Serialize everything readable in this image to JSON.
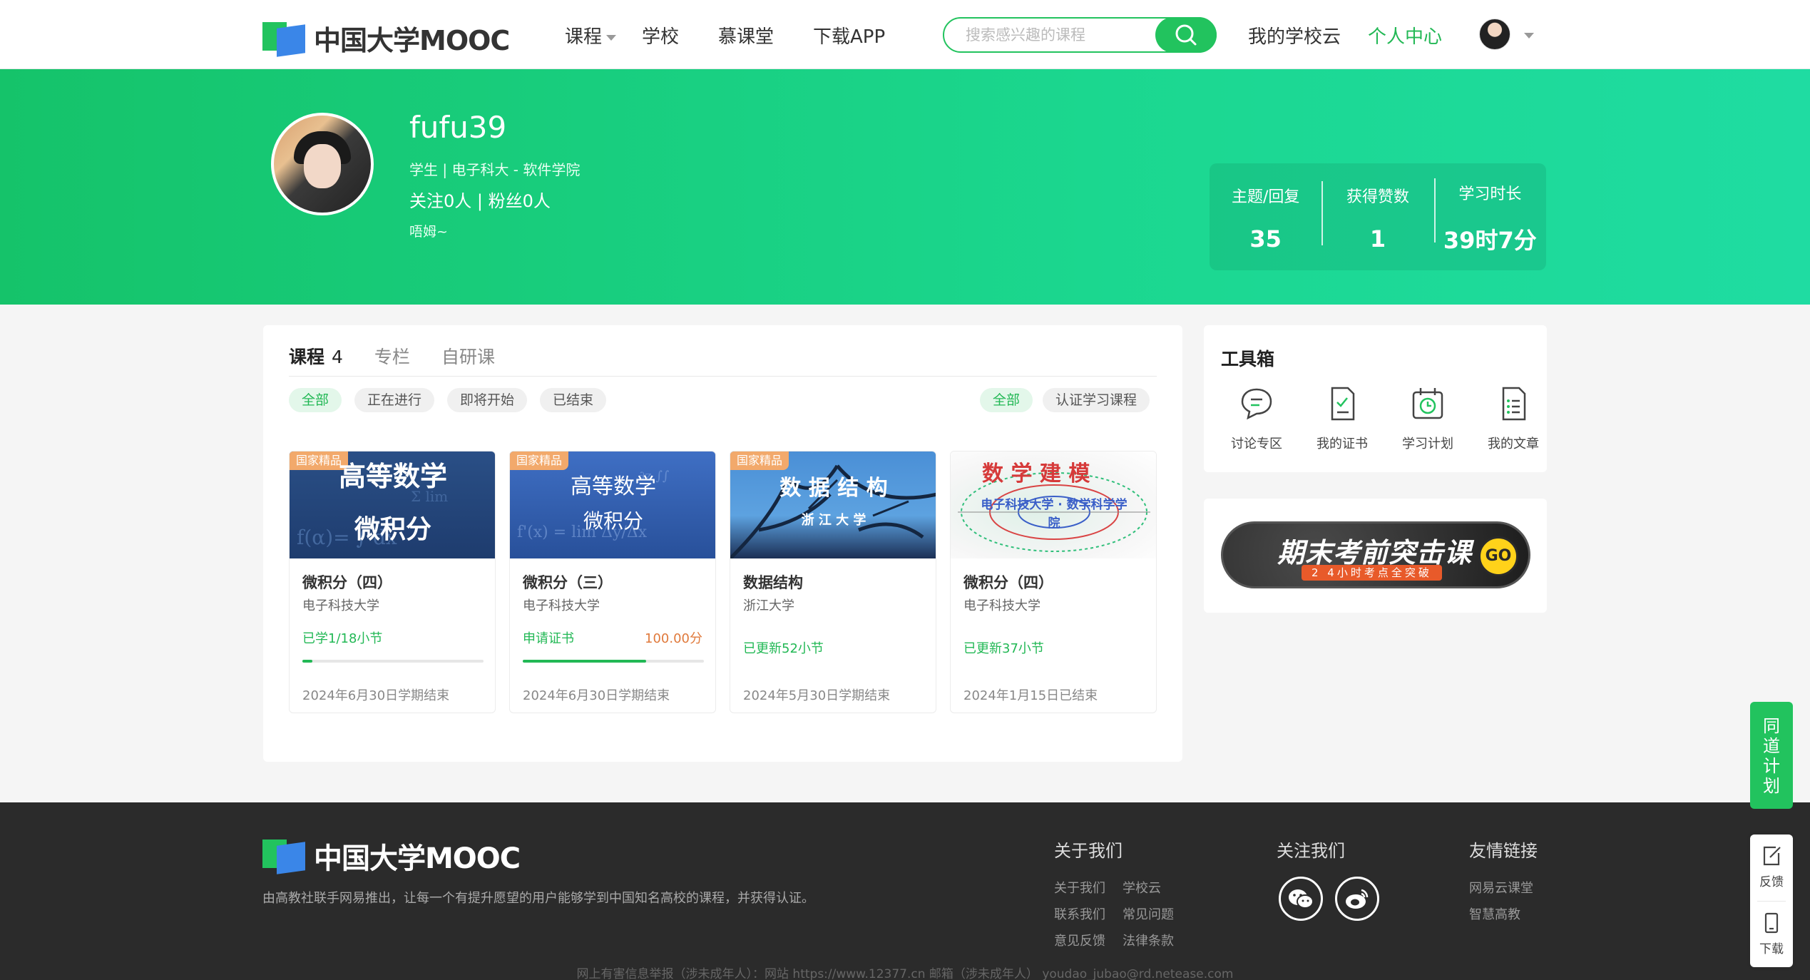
{
  "brand": {
    "logo_text": "中国大学MOOC"
  },
  "nav": {
    "courses": "课程",
    "schools": "学校",
    "mooc_hall": "慕课堂",
    "download_app": "下载APP",
    "my_school_cloud": "我的学校云",
    "personal_center": "个人中心",
    "search_placeholder": "搜索感兴趣的课程"
  },
  "colors": {
    "accent": "#22c35e",
    "progress": "#22b855",
    "badge": "#f2a96b",
    "score": "#e07a3c"
  },
  "profile": {
    "username": "fufu39",
    "meta": "学生 | 电子科大 - 软件学院",
    "follow": "关注0人 | 粉丝0人",
    "bio": "唔姆~",
    "stats": [
      {
        "label": "主题/回复",
        "value": "35"
      },
      {
        "label": "获得赞数",
        "value": "1"
      },
      {
        "label": "学习时长",
        "value": "39时7分"
      }
    ]
  },
  "main": {
    "tabs": [
      {
        "label": "课程",
        "count": "4"
      },
      {
        "label": "专栏"
      },
      {
        "label": "自研课"
      }
    ],
    "filters": [
      "全部",
      "正在进行",
      "即将开始",
      "已结束"
    ],
    "filters_right": [
      "全部",
      "认证学习课程"
    ],
    "courses": [
      {
        "badge": "国家精品",
        "cover_title": "高等数学",
        "cover_sub": "微积分",
        "name": "微积分（四）",
        "school": "电子科技大学",
        "status": "已学1/18小节",
        "progress": 0.056,
        "end": "2024年6月30日学期结束"
      },
      {
        "badge": "国家精品",
        "cover_title": "高等数学",
        "cover_sub": "微积分",
        "name": "微积分（三）",
        "school": "电子科技大学",
        "status": "申请证书",
        "score": "100.00分",
        "progress": 0.68,
        "end": "2024年6月30日学期结束"
      },
      {
        "badge": "国家精品",
        "cover_title": "数 据 结 构",
        "cover_sub": "浙 江 大 学",
        "name": "数据结构",
        "school": "浙江大学",
        "status": "已更新52小节",
        "end": "2024年5月30日学期结束"
      },
      {
        "cover_title": "数 学 建 模",
        "cover_sub": "电子科技大学 · 数学科学学院",
        "name": "微积分（四）",
        "school": "电子科技大学",
        "status": "已更新37小节",
        "end": "2024年1月15日已结束"
      }
    ]
  },
  "toolbox": {
    "title": "工具箱",
    "items": [
      {
        "label": "讨论专区",
        "icon": "discussion-icon"
      },
      {
        "label": "我的证书",
        "icon": "certificate-icon"
      },
      {
        "label": "学习计划",
        "icon": "study-plan-icon"
      },
      {
        "label": "我的文章",
        "icon": "article-icon"
      }
    ]
  },
  "promo": {
    "title": "期末考前突击课",
    "sub": "2 4小时考点全突破",
    "go": "GO"
  },
  "floating": {
    "plan": "同道计划",
    "feedback": "反馈",
    "download": "下载"
  },
  "footer": {
    "logo_text": "中国大学MOOC",
    "desc": "由高教社联手网易推出，让每一个有提升愿望的用户能够学到中国知名高校的课程，并获得认证。",
    "about_title": "关于我们",
    "about_links": [
      "关于我们",
      "学校云",
      "联系我们",
      "常见问题",
      "意见反馈",
      "法律条款"
    ],
    "follow_title": "关注我们",
    "friends_title": "友情链接",
    "friends_links": [
      "网易云课堂",
      "智慧高教"
    ],
    "bottom": "网上有害信息举报（涉未成年人）：网站 https://www.12377.cn 邮箱（涉未成年人） youdao_jubao@rd.netease.com"
  }
}
